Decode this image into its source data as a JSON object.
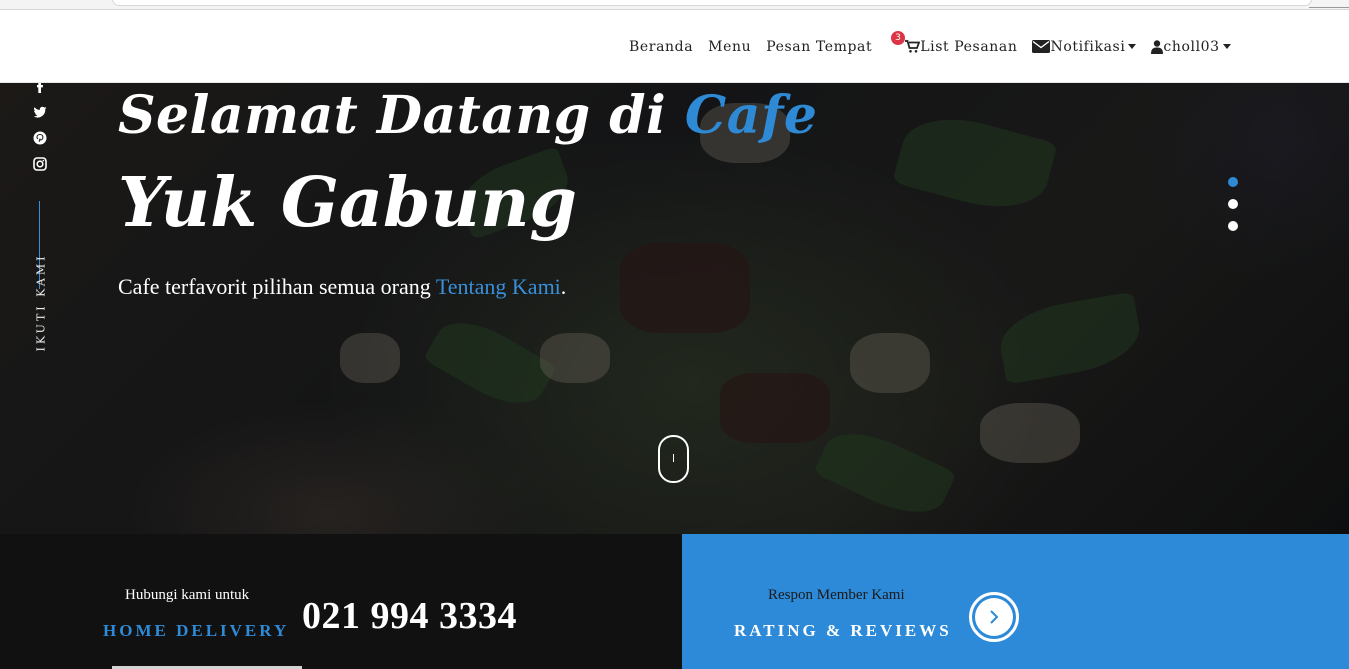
{
  "navbar": {
    "items": [
      {
        "label": "Beranda"
      },
      {
        "label": "Menu"
      },
      {
        "label": "Pesan Tempat"
      },
      {
        "label": "List Pesanan",
        "icon": "cart-icon",
        "badge": "3"
      },
      {
        "label": "Notifikasi",
        "icon": "envelope-icon",
        "dropdown": true
      },
      {
        "label": "choll03",
        "icon": "user-icon",
        "dropdown": true
      }
    ]
  },
  "social": {
    "icons": [
      "facebook-icon",
      "twitter-icon",
      "pinterest-icon",
      "instagram-icon"
    ],
    "follow_label": "IKUTI KAMI"
  },
  "hero": {
    "title_prefix": "Selamat Datang di ",
    "title_accent": "Cafe",
    "title_line2": "Yuk Gabung",
    "subtitle_prefix": "Cafe terfavorit pilihan semua orang ",
    "subtitle_link": "Tentang Kami",
    "subtitle_suffix": ".",
    "slide_count": 3,
    "active_slide": 1
  },
  "contact": {
    "label": "Hubungi kami untuk",
    "service": "HOME DELIVERY",
    "phone": "021 994 3334"
  },
  "reviews": {
    "label": "Respon Member Kami",
    "title": "RATING & REVIEWS"
  },
  "colors": {
    "accent": "#2f8ad6",
    "badge": "#dc3545",
    "dark": "#111111",
    "blue_panel": "#2d8ad8"
  }
}
